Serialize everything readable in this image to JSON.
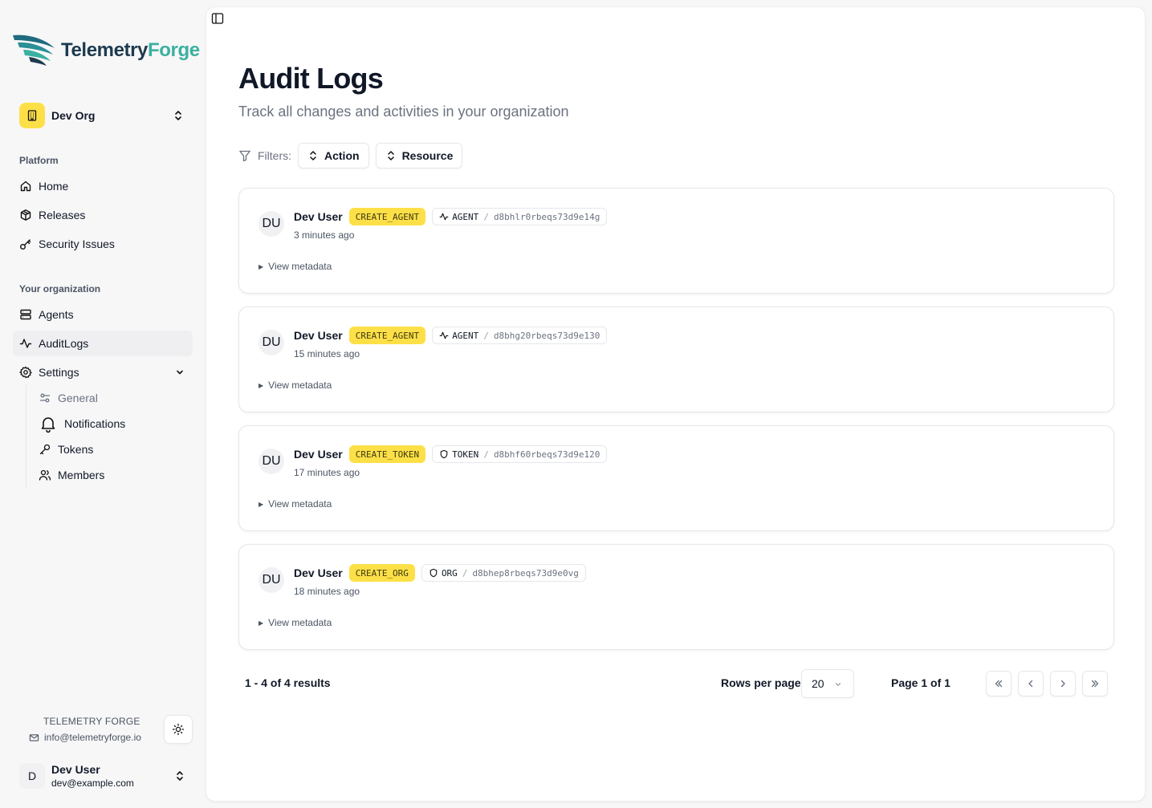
{
  "brand": {
    "name_part1": "Telemetry",
    "name_part2": "Forge"
  },
  "org": {
    "name": "Dev Org"
  },
  "sidebar": {
    "platform_label": "Platform",
    "platform_items": [
      {
        "label": "Home",
        "icon": "home-icon"
      },
      {
        "label": "Releases",
        "icon": "package-icon"
      },
      {
        "label": "Security Issues",
        "icon": "key-icon"
      }
    ],
    "org_label": "Your organization",
    "org_items": [
      {
        "label": "Agents",
        "icon": "server-icon"
      },
      {
        "label": "AuditLogs",
        "icon": "activity-icon",
        "active": true
      },
      {
        "label": "Settings",
        "icon": "gear-icon"
      }
    ],
    "settings_items": [
      {
        "label": "General",
        "icon": "sliders-icon"
      },
      {
        "label": "Notifications",
        "icon": "bell-icon"
      },
      {
        "label": "Tokens",
        "icon": "key-icon"
      },
      {
        "label": "Members",
        "icon": "users-icon"
      }
    ],
    "footer": {
      "brand": "TELEMETRY FORGE",
      "email": "info@telemetryforge.io"
    },
    "user": {
      "initial": "D",
      "name": "Dev User",
      "email": "dev@example.com"
    }
  },
  "page": {
    "title": "Audit Logs",
    "subtitle": "Track all changes and activities in your organization",
    "filters_label": "Filters:",
    "filter_action": "Action",
    "filter_resource": "Resource"
  },
  "logs": [
    {
      "initials": "DU",
      "user": "Dev User",
      "action": "CREATE_AGENT",
      "resource_type": "AGENT",
      "sep": "/",
      "resource_id": "d8bhlr0rbeqs73d9e14g",
      "time": "3 minutes ago",
      "meta_label": "View metadata"
    },
    {
      "initials": "DU",
      "user": "Dev User",
      "action": "CREATE_AGENT",
      "resource_type": "AGENT",
      "sep": "/",
      "resource_id": "d8bhg20rbeqs73d9e130",
      "time": "15 minutes ago",
      "meta_label": "View metadata"
    },
    {
      "initials": "DU",
      "user": "Dev User",
      "action": "CREATE_TOKEN",
      "resource_type": "TOKEN",
      "sep": "/",
      "resource_id": "d8bhf60rbeqs73d9e120",
      "time": "17 minutes ago",
      "meta_label": "View metadata"
    },
    {
      "initials": "DU",
      "user": "Dev User",
      "action": "CREATE_ORG",
      "resource_type": "ORG",
      "sep": "/",
      "resource_id": "d8bhep8rbeqs73d9e0vg",
      "time": "18 minutes ago",
      "meta_label": "View metadata"
    }
  ],
  "pagination": {
    "results": "1 - 4 of 4 results",
    "rows_label": "Rows per page",
    "rows_value": "20",
    "page_label": "Page 1 of 1"
  },
  "colors": {
    "accent": "#fde047",
    "brand_dark": "#1e3a4f",
    "brand_teal": "#3bb0a0"
  }
}
